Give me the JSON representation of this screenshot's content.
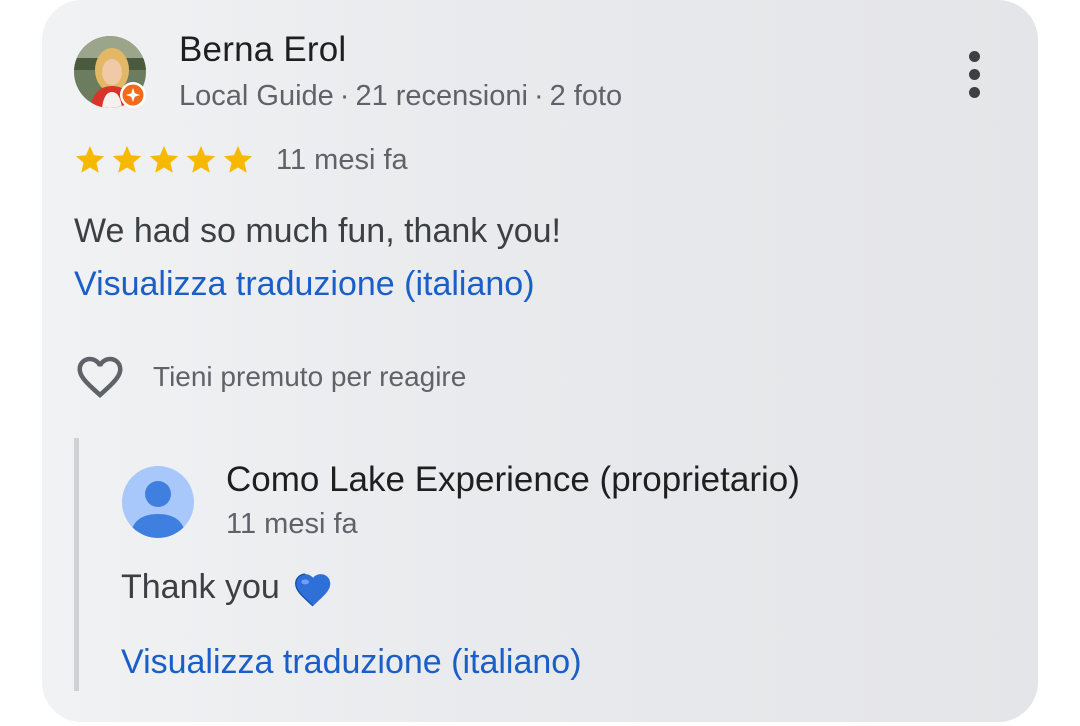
{
  "review": {
    "author": {
      "name": "Berna Erol",
      "badge": "Local Guide",
      "reviews": "21 recensioni",
      "photos": "2 foto",
      "separator": "·",
      "avatar_icon": "profile-photo",
      "badge_icon": "local-guide-star-badge"
    },
    "rating": 5,
    "rating_max": 5,
    "star_color": "#f6b900",
    "date": "11 mesi fa",
    "text": "We had so much fun, thank you!",
    "translate_link": "Visualizza traduzione (italiano)",
    "react_hint": "Tieni premuto per reagire",
    "more_icon": "more-vert-icon",
    "react_icon": "heart-outline-icon"
  },
  "owner_reply": {
    "name": "Como Lake Experience (proprietario)",
    "date": "11 mesi fa",
    "text": "Thank you",
    "emoji_icon": "blue-heart-emoji",
    "translate_link": "Visualizza traduzione (italiano)",
    "avatar_icon": "default-person-avatar"
  },
  "colors": {
    "link": "#1a5fc8",
    "secondary_text": "#5f6368",
    "primary_text": "#1f1f1f",
    "badge_orange": "#f26b1d",
    "owner_avatar_bg": "#a8c7fa",
    "owner_avatar_fg": "#3f7fe0"
  }
}
